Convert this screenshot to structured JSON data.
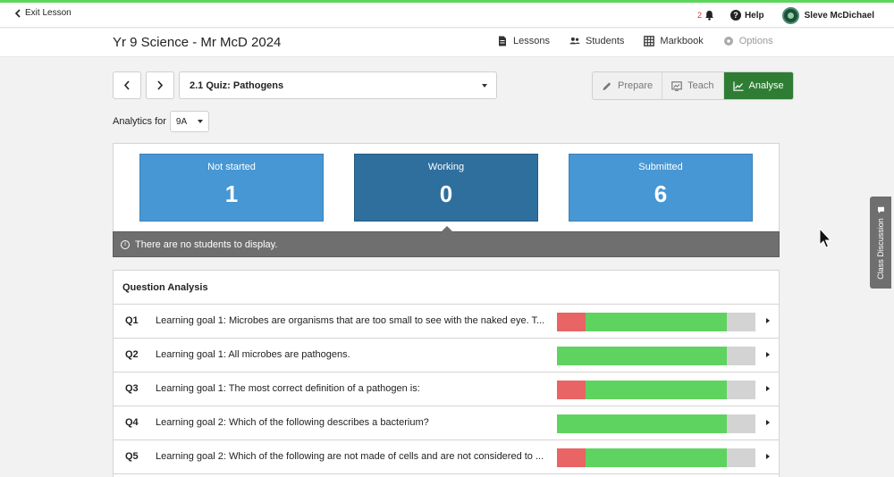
{
  "topbar": {
    "exit_label": "Exit Lesson",
    "notification_count": "2",
    "help_label": "Help",
    "user_name": "Sleve McDichael"
  },
  "classbar": {
    "title": "Yr 9 Science - Mr McD 2024",
    "nav": [
      {
        "label": "Lessons",
        "icon": "document-icon"
      },
      {
        "label": "Students",
        "icon": "people-icon"
      },
      {
        "label": "Markbook",
        "icon": "grid-icon"
      },
      {
        "label": "Options",
        "icon": "gear-icon"
      }
    ]
  },
  "lesson": {
    "selected": "2.1 Quiz: Pathogens"
  },
  "modes": [
    {
      "label": "Prepare",
      "icon": "pencil-icon",
      "active": false
    },
    {
      "label": "Teach",
      "icon": "presentation-icon",
      "active": false
    },
    {
      "label": "Analyse",
      "icon": "chart-icon",
      "active": true
    }
  ],
  "analytics": {
    "label": "Analytics for",
    "group": "9A"
  },
  "status": [
    {
      "label": "Not started",
      "value": "1"
    },
    {
      "label": "Working",
      "value": "0"
    },
    {
      "label": "Submitted",
      "value": "6"
    }
  ],
  "empty_message": "There are no students to display.",
  "question_analysis": {
    "title": "Question Analysis",
    "questions": [
      {
        "num": "Q1",
        "text": "Learning goal 1: Microbes are organisms that are too small to see with the naked eye. T...",
        "incorrect": 0.143,
        "correct": 0.714,
        "not_answered": 0.143
      },
      {
        "num": "Q2",
        "text": "Learning goal 1: All microbes are pathogens.",
        "incorrect": 0,
        "correct": 0.857,
        "not_answered": 0.143
      },
      {
        "num": "Q3",
        "text": "Learning goal 1: The most correct definition of a pathogen is:",
        "incorrect": 0.143,
        "correct": 0.714,
        "not_answered": 0.143
      },
      {
        "num": "Q4",
        "text": "Learning goal 2: Which of the following describes a bacterium?",
        "incorrect": 0,
        "correct": 0.857,
        "not_answered": 0.143
      },
      {
        "num": "Q5",
        "text": "Learning goal 2: Which of the following are not made of cells and are not considered to ...",
        "incorrect": 0.143,
        "correct": 0.714,
        "not_answered": 0.143
      }
    ]
  },
  "discussion_tab": "Class Discussion",
  "colors": {
    "accent_green": "#2f7d34",
    "top_strip": "#5cd65c",
    "stat_blue": "#4797d4",
    "stat_blue_selected": "#2e6f9e",
    "bar_incorrect": "#e96464",
    "bar_correct": "#5fd35f",
    "bar_none": "#d3d3d3"
  }
}
